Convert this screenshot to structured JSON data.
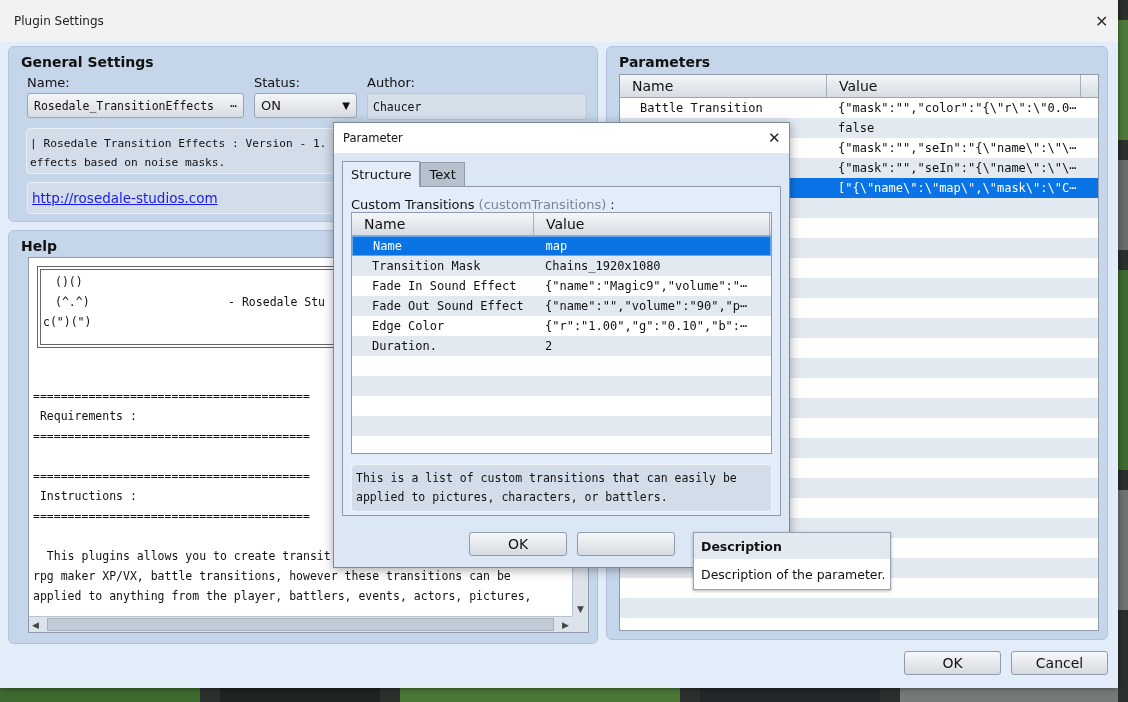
{
  "window": {
    "title": "Plugin Settings",
    "close": "✕"
  },
  "general": {
    "title": "General Settings",
    "name_label": "Name:",
    "name_value": "Rosedale_TransitionEffects",
    "name_more": "⋯",
    "status_label": "Status:",
    "status_value": "ON",
    "status_caret": "▼",
    "author_label": "Author:",
    "author_value": "Chaucer",
    "description_lines": [
      "| Rosedale Transition Effects : Version - 1.",
      "effects based on noise masks."
    ],
    "link": "http://rosedale-studios.com"
  },
  "help": {
    "title": "Help",
    "art_lines": [
      "()()",
      "(^.^)                    - Rosedale Stu",
      "c(\")(\")"
    ],
    "sections": [
      {
        "rule_top": "========================================",
        "title": "Requirements :",
        "rule_bottom": "========================================"
      },
      {
        "rule_top": "========================================",
        "title": "Instructions :",
        "rule_bottom": "========================================"
      }
    ],
    "paragraph_lines": [
      "  This plugins allows you to create transit",
      "rpg maker XP/VX, battle transitions, however these transitions can be",
      "applied to anything from the player, battlers, events, actors, pictures,"
    ],
    "scroll_down": "▼",
    "scroll_left": "◀",
    "scroll_right": "▶"
  },
  "parameters": {
    "title": "Parameters",
    "columns": [
      "Name",
      "Value"
    ],
    "rows": [
      {
        "name": "Battle Transition",
        "value": "{\"mask\":\"\",\"color\":\"{\\\"r\\\":\\\"0.0⋯",
        "selected": false
      },
      {
        "value": "false",
        "selected": false
      },
      {
        "value": "{\"mask\":\"\",\"seIn\":\"{\\\"name\\\":\\\"\\⋯",
        "selected": false
      },
      {
        "value": "{\"mask\":\"\",\"seIn\":\"{\\\"name\\\":\\\"\\⋯",
        "selected": false
      },
      {
        "value": "[\"{\\\"name\\\":\\\"map\\\",\\\"mask\\\":\\\"C⋯",
        "selected": true
      }
    ]
  },
  "buttons": [
    "OK",
    "Cancel"
  ],
  "dialog": {
    "title": "Parameter",
    "close": "✕",
    "tabs": [
      {
        "label": "Structure",
        "selected": true
      },
      {
        "label": "Text",
        "selected": false
      }
    ],
    "field_label": "Custom Transitions",
    "field_key": "(customTransitions)",
    "field_colon": ":",
    "columns": [
      "Name",
      "Value"
    ],
    "rows": [
      {
        "name": "Name",
        "value": "map",
        "selected": true
      },
      {
        "name": "Transition Mask",
        "value": "Chains_1920x1080",
        "selected": false
      },
      {
        "name": "Fade In Sound Effect",
        "value": "{\"name\":\"Magic9\",\"volume\":\"⋯",
        "selected": false
      },
      {
        "name": "Fade Out Sound Effect",
        "value": "{\"name\":\"\",\"volume\":\"90\",\"p⋯",
        "selected": false
      },
      {
        "name": "Edge Color",
        "value": "{\"r\":\"1.00\",\"g\":\"0.10\",\"b\":⋯",
        "selected": false
      },
      {
        "name": "Duration.",
        "value": "2",
        "selected": false
      }
    ],
    "description_lines": [
      "This is a list of custom transitions that can easily be",
      "applied to pictures, characters, or battlers."
    ],
    "ok": "OK"
  },
  "tooltip": {
    "title": "Description",
    "text": "Description of the parameter."
  }
}
